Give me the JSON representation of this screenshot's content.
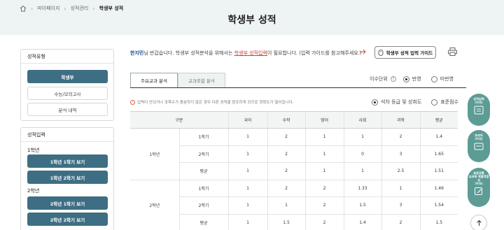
{
  "breadcrumb": {
    "items": [
      "마이페이지",
      "성적관리",
      "학생부 성적"
    ]
  },
  "page_title": "학생부 성적",
  "sidebar": {
    "type_box": {
      "title": "성적유형",
      "buttons": [
        "학생부",
        "수능/모의고사",
        "분석 내역"
      ]
    },
    "input_box": {
      "title": "성적입력",
      "grade1": {
        "label": "1학년",
        "buttons": [
          "1학년 1학기 보기",
          "1학년 2학기 보기"
        ]
      },
      "grade2": {
        "label": "2학년",
        "buttons": [
          "2학년 1학기 보기",
          "2학년 2학기 보기"
        ]
      }
    }
  },
  "greeting": {
    "name": "한지민",
    "text1": "님 반갑습니다. 학생부 성적분석을 위해서는 ",
    "link": "학생부 성적입력",
    "text2": "이 필요합니다. (입력 가이드를 참고해주세요.)"
  },
  "guide_button": "학생부 성적 입력 가이드",
  "tabs": [
    "주요교과 분석",
    "교과조합 분석"
  ],
  "completion": {
    "label": "이수단위",
    "options": [
      "반영",
      "미반영"
    ],
    "selected": "반영"
  },
  "notice": "입력이 안되거나 과목수가 충분하지 않은 경우 다른 성적을 참조하게 되므로 정확도가 떨어집니다.",
  "view_mode": {
    "options": [
      "석차 등급 및 성취도",
      "표준점수"
    ],
    "selected": "석차 등급 및 성취도"
  },
  "table": {
    "headers": [
      "구분",
      "국어",
      "수학",
      "영어",
      "사회",
      "과학",
      "평균"
    ],
    "groups": [
      {
        "grade": "1학년",
        "rows": [
          {
            "term": "1학기",
            "values": [
              "1",
              "2",
              "1",
              "1",
              "2",
              "1.4"
            ]
          },
          {
            "term": "2학기",
            "values": [
              "1",
              "2",
              "1",
              "0",
              "3",
              "1.65"
            ]
          },
          {
            "term": "평균",
            "values": [
              "1",
              "2",
              "1",
              "1",
              "2.5",
              "1.51"
            ]
          }
        ]
      },
      {
        "grade": "2학년",
        "rows": [
          {
            "term": "1학기",
            "values": [
              "1",
              "2",
              "2",
              "1.33",
              "1",
              "1.46"
            ]
          },
          {
            "term": "2학기",
            "values": [
              "1",
              "1",
              "2",
              "1.5",
              "3",
              "1.54"
            ]
          },
          {
            "term": "평균",
            "values": [
              "1",
              "1.5",
              "2",
              "1.4",
              "2",
              "1.5"
            ]
          }
        ]
      }
    ]
  },
  "float": {
    "b1": [
      "성적입력",
      "가이드"
    ],
    "b2": [
      "초보자",
      "가이드"
    ],
    "b3": [
      "표준공통",
      "교과목 계열적합성",
      "가이드"
    ]
  },
  "colors": {
    "primary": "#3e6e84",
    "float": "#5c9c95",
    "band": "#eef4f4",
    "link": "#c9423a"
  }
}
